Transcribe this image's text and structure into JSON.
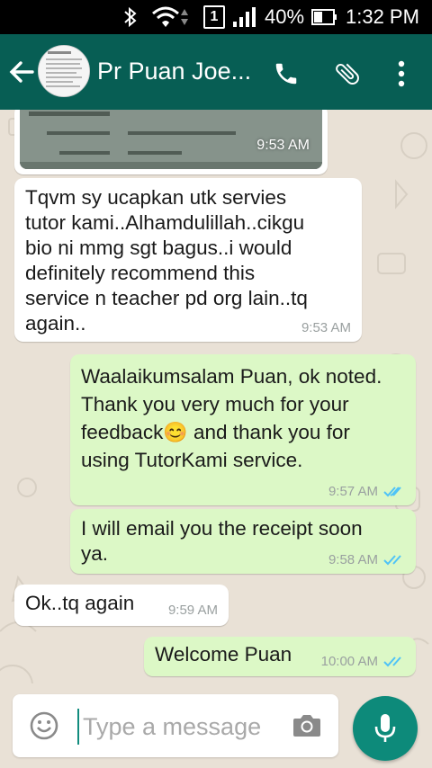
{
  "status_bar": {
    "sim_label": "1",
    "battery": "40%",
    "time": "1:32 PM"
  },
  "header": {
    "contact_name": "Pr Puan Joe...",
    "icons": [
      "back-arrow-icon",
      "phone-icon",
      "paperclip-icon",
      "more-vert-icon"
    ]
  },
  "messages": [
    {
      "type": "image",
      "direction": "in",
      "time": "9:53 AM"
    },
    {
      "type": "text",
      "direction": "in",
      "text": "Tqvm sy ucapkan utk servies\ntutor kami..Alhamdulillah..cikgu\nbio ni mmg sgt bagus..i would\ndefinitely recommend this\nservice n teacher pd org lain..tq\nagain..",
      "time": "9:53 AM"
    },
    {
      "type": "text",
      "direction": "out",
      "text_before_emoji": "Waalaikumsalam Puan, ok noted.\nThank you very much for your\nfeedback",
      "emoji": "😊",
      "text_after_emoji": " and thank you for\nusing TutorKami service.",
      "time": "9:57 AM"
    },
    {
      "type": "text",
      "direction": "out",
      "text": "I will email you the receipt soon\nya.",
      "time": "9:58 AM"
    },
    {
      "type": "text",
      "direction": "in",
      "text": "Ok..tq again",
      "time": "9:59 AM"
    },
    {
      "type": "text",
      "direction": "out",
      "text": "Welcome Puan",
      "time": "10:00 AM"
    }
  ],
  "composer": {
    "placeholder": "Type a message",
    "value": ""
  },
  "colors": {
    "header": "#075e54",
    "outgoing_bubble": "#dcf8c6",
    "incoming_bubble": "#ffffff",
    "read_ticks": "#4fc3f7",
    "mic_button": "#0d8a7a"
  }
}
